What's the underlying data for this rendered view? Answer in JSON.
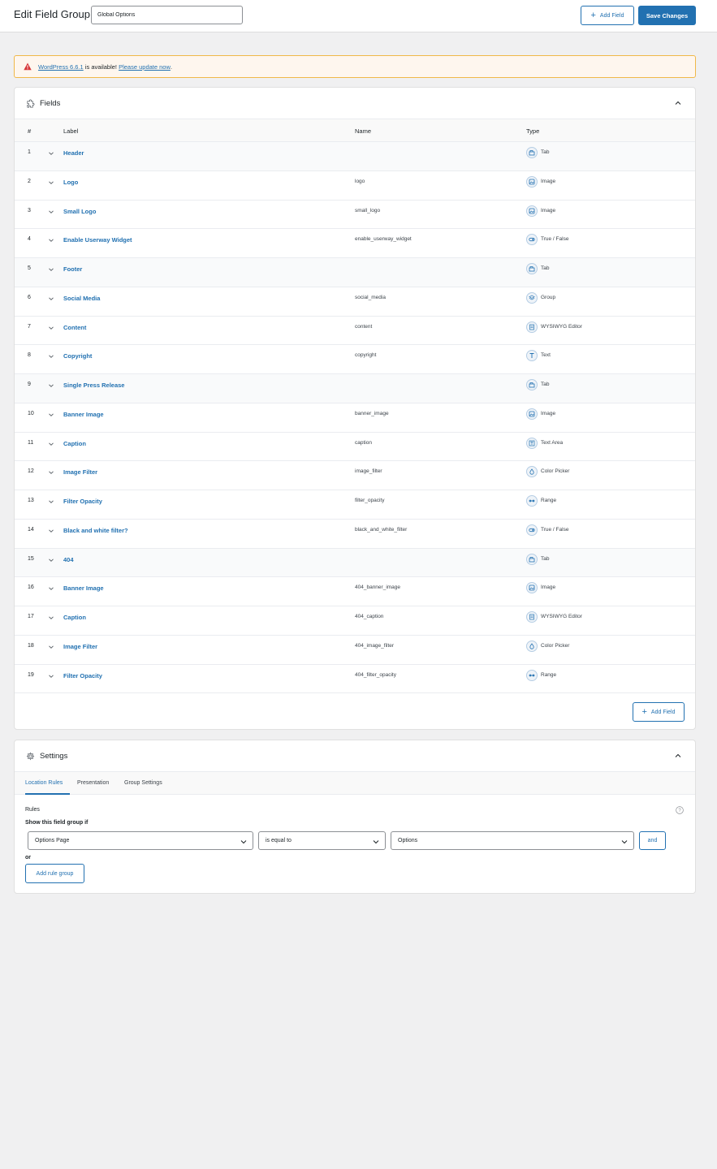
{
  "header": {
    "title": "Edit Field Group",
    "group_title_value": "Global Options",
    "add_field_label": "Add Field",
    "save_label": "Save Changes"
  },
  "notice": {
    "link_version": "WordPress 6.6.1",
    "middle_text": " is available! ",
    "link_update": "Please update now",
    "end_text": "."
  },
  "fields_panel": {
    "title": "Fields",
    "columns": {
      "num": "#",
      "label": "Label",
      "name": "Name",
      "type": "Type"
    },
    "rows": [
      {
        "num": "1",
        "label": "Header",
        "name": "",
        "type": "Tab",
        "icon": "tab-icon"
      },
      {
        "num": "2",
        "label": "Logo",
        "name": "logo",
        "type": "Image",
        "icon": "image-icon"
      },
      {
        "num": "3",
        "label": "Small Logo",
        "name": "small_logo",
        "type": "Image",
        "icon": "image-icon"
      },
      {
        "num": "4",
        "label": "Enable Userway Widget",
        "name": "enable_userway_widget",
        "type": "True / False",
        "icon": "toggle-icon"
      },
      {
        "num": "5",
        "label": "Footer",
        "name": "",
        "type": "Tab",
        "icon": "tab-icon"
      },
      {
        "num": "6",
        "label": "Social Media",
        "name": "social_media",
        "type": "Group",
        "icon": "group-icon"
      },
      {
        "num": "7",
        "label": "Content",
        "name": "content",
        "type": "WYSIWYG Editor",
        "icon": "editor-icon"
      },
      {
        "num": "8",
        "label": "Copyright",
        "name": "copyright",
        "type": "Text",
        "icon": "text-icon"
      },
      {
        "num": "9",
        "label": "Single Press Release",
        "name": "",
        "type": "Tab",
        "icon": "tab-icon"
      },
      {
        "num": "10",
        "label": "Banner Image",
        "name": "banner_image",
        "type": "Image",
        "icon": "image-icon"
      },
      {
        "num": "11",
        "label": "Caption",
        "name": "caption",
        "type": "Text Area",
        "icon": "textarea-icon"
      },
      {
        "num": "12",
        "label": "Image Filter",
        "name": "image_filter",
        "type": "Color Picker",
        "icon": "color-picker-icon"
      },
      {
        "num": "13",
        "label": "Filter Opacity",
        "name": "filter_opacity",
        "type": "Range",
        "icon": "range-icon"
      },
      {
        "num": "14",
        "label": "Black and white filter?",
        "name": "black_and_white_filter",
        "type": "True / False",
        "icon": "toggle-icon"
      },
      {
        "num": "15",
        "label": "404",
        "name": "",
        "type": "Tab",
        "icon": "tab-icon"
      },
      {
        "num": "16",
        "label": "Banner Image",
        "name": "404_banner_image",
        "type": "Image",
        "icon": "image-icon"
      },
      {
        "num": "17",
        "label": "Caption",
        "name": "404_caption",
        "type": "WYSIWYG Editor",
        "icon": "editor-icon"
      },
      {
        "num": "18",
        "label": "Image Filter",
        "name": "404_image_filter",
        "type": "Color Picker",
        "icon": "color-picker-icon"
      },
      {
        "num": "19",
        "label": "Filter Opacity",
        "name": "404_filter_opacity",
        "type": "Range",
        "icon": "range-icon"
      }
    ],
    "add_field_label": "Add Field"
  },
  "settings_panel": {
    "title": "Settings",
    "tabs": [
      "Location Rules",
      "Presentation",
      "Group Settings"
    ],
    "rules_label": "Rules",
    "show_if_label": "Show this field group if",
    "param_value": "Options Page",
    "operator_value": "is equal to",
    "value_value": "Options",
    "and_label": "and",
    "or_label": "or",
    "add_rule_group_label": "Add rule group"
  },
  "colors": {
    "accent": "#2271b1",
    "background": "#f0f0f1",
    "notice_bg": "#fef6ee",
    "warning": "#d63638"
  }
}
